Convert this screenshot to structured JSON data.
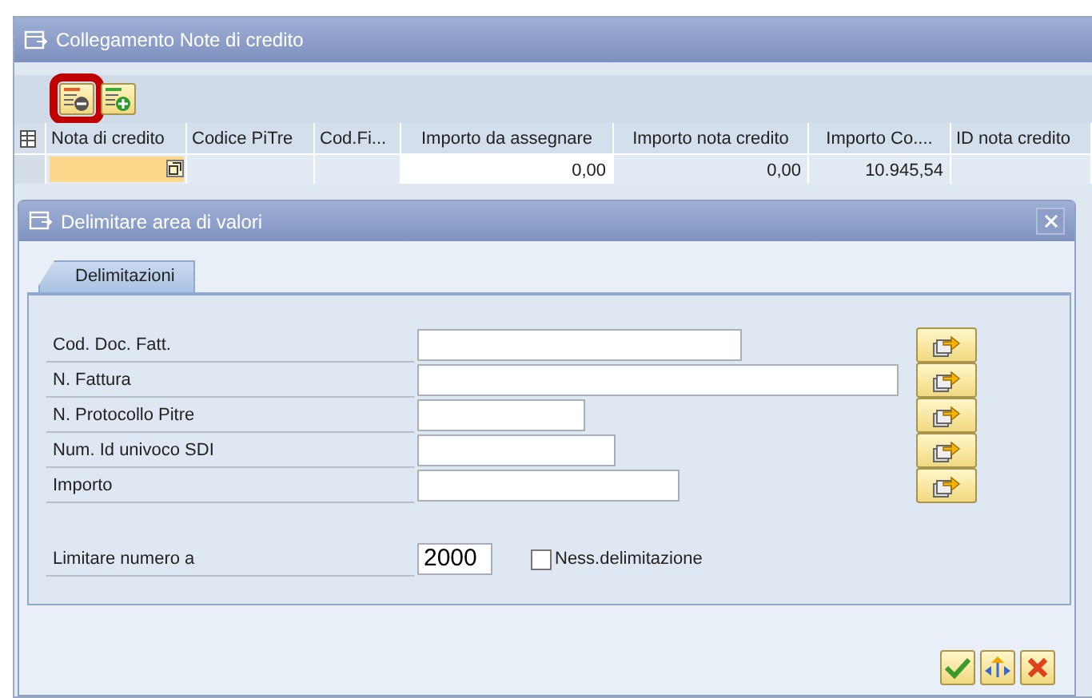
{
  "window": {
    "title": "Collegamento Note di credito"
  },
  "toolbar": [
    {
      "kind": "remove",
      "highlighted": true
    },
    {
      "kind": "add",
      "highlighted": false
    }
  ],
  "table": {
    "columns": [
      "Nota di credito",
      "Codice PiTre",
      "Cod.Fi...",
      "Importo da assegnare",
      "Importo nota credito",
      "Importo Co....",
      "ID nota credito"
    ],
    "rows": [
      {
        "cells": [
          null,
          null,
          null,
          "0,00",
          "0,00",
          "10.945,54",
          null
        ]
      }
    ]
  },
  "dialog": {
    "title": "Delimitare area di valori",
    "tabs": [
      {
        "label": "Delimitazioni",
        "selected": true
      }
    ],
    "fields": [
      {
        "label": "Cod. Doc. Fatt."
      },
      {
        "label": "N. Fattura"
      },
      {
        "label": "N. Protocollo Pitre"
      },
      {
        "label": "Num. Id univoco SDI"
      },
      {
        "label": "Importo"
      }
    ],
    "limit": {
      "label": "Limitare numero a",
      "value": "2000"
    },
    "no_limit": {
      "label": "Ness.delimitazione",
      "checked": false
    },
    "buttons": [
      {
        "kind": "ok"
      },
      {
        "kind": "multiple"
      },
      {
        "kind": "cancel"
      }
    ]
  }
}
